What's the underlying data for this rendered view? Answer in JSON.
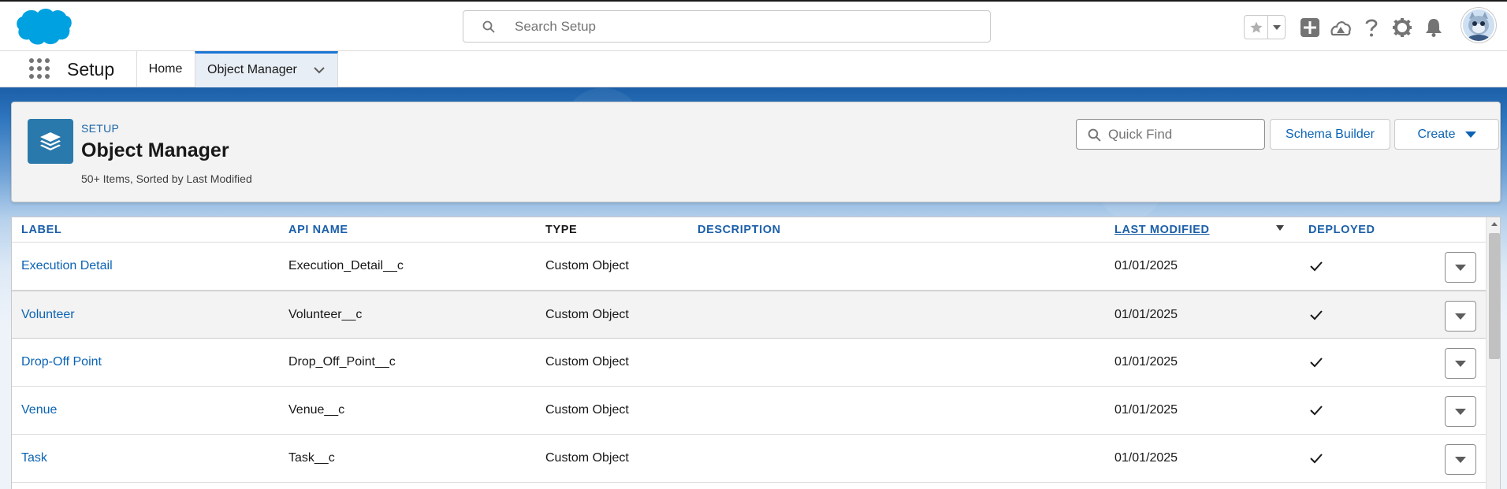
{
  "global_header": {
    "search_placeholder": "Search Setup",
    "icons": [
      "favorites-star-icon",
      "favorites-menu-icon",
      "global-actions-add-icon",
      "trailhead-icon",
      "help-icon",
      "setup-gear-icon",
      "notifications-bell-icon",
      "user-avatar"
    ]
  },
  "context_bar": {
    "app_name": "Setup",
    "tabs": [
      {
        "label": "Home",
        "active": false
      },
      {
        "label": "Object Manager",
        "active": true
      }
    ]
  },
  "page_header": {
    "eyebrow": "SETUP",
    "title": "Object Manager",
    "meta": "50+ Items, Sorted by Last Modified",
    "quick_find_placeholder": "Quick Find",
    "schema_builder_label": "Schema Builder",
    "create_label": "Create"
  },
  "table": {
    "columns": [
      "LABEL",
      "API NAME",
      "TYPE",
      "DESCRIPTION",
      "LAST MODIFIED",
      "DEPLOYED"
    ],
    "sorted_column": "LAST MODIFIED",
    "rows": [
      {
        "label": "Execution Detail",
        "api_name": "Execution_Detail__c",
        "type": "Custom Object",
        "description": "",
        "last_modified": "01/01/2025",
        "deployed": true
      },
      {
        "label": "Volunteer",
        "api_name": "Volunteer__c",
        "type": "Custom Object",
        "description": "",
        "last_modified": "01/01/2025",
        "deployed": true
      },
      {
        "label": "Drop-Off Point",
        "api_name": "Drop_Off_Point__c",
        "type": "Custom Object",
        "description": "",
        "last_modified": "01/01/2025",
        "deployed": true
      },
      {
        "label": "Venue",
        "api_name": "Venue__c",
        "type": "Custom Object",
        "description": "",
        "last_modified": "01/01/2025",
        "deployed": true
      },
      {
        "label": "Task",
        "api_name": "Task__c",
        "type": "Custom Object",
        "description": "",
        "last_modified": "01/01/2025",
        "deployed": true
      }
    ]
  },
  "colors": {
    "brand_blue": "#0b63b3",
    "header_blue": "#1b5fa8",
    "object_icon_bg": "#2a79ac",
    "salesforce_cloud": "#00a1e0"
  }
}
